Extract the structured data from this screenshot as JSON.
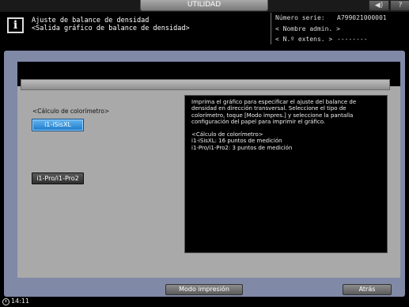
{
  "top_tab": {
    "label": "UTILIDAD"
  },
  "top_buttons": {
    "volume_icon": "speaker-icon",
    "help_label": "?"
  },
  "header": {
    "title_line1": "Ajuste de balance de densidad",
    "title_line2": "<Salida gráfico de balance de densidad>",
    "serial_label": "Número serie:",
    "serial_value": "A799021000001",
    "admin_label": "< Nombre admin. >",
    "ext_label": "< N.º extens. >",
    "ext_value": "--------"
  },
  "main": {
    "colorimeter_label": "<Cálculo de colorímetro>",
    "options": [
      {
        "label": "i1-iSisXL",
        "selected": true
      },
      {
        "label": "i1-Pro/i1-Pro2",
        "selected": false
      }
    ],
    "info": {
      "paragraph": "Imprima el gráfico para especificar el ajuste del balance de densidad en dirección transversal. Seleccione el tipo de colorímetro, toque [Modo impres.] y seleccione la pantalla configuración del papel para imprimir el gráfico.",
      "calc_heading": "<Cálculo de colorímetro>",
      "calc_line1": "i1-iSisXL: 16 puntos de medición",
      "calc_line2": "i1-Pro/i1-Pro2: 3 puntos de medición"
    }
  },
  "footer": {
    "print_mode_label": "Modo impresión",
    "back_label": "Atrás",
    "clock": "14:11"
  },
  "colors": {
    "selected_button": "#1b79c9",
    "panel": "#8089a6"
  }
}
